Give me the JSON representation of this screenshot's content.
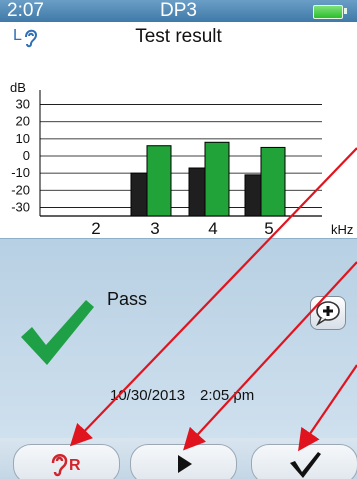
{
  "status_bar": {
    "time": "2:07",
    "title": "DP3",
    "battery_icon": "battery-full-icon"
  },
  "chart_panel": {
    "title": "Test result",
    "ear_icon": "left-ear-icon",
    "ear_label": "L"
  },
  "chart_data": {
    "type": "bar",
    "ylabel": "dB",
    "xlabel": "kHz",
    "ylim": [
      -35,
      35
    ],
    "yticks": [
      30,
      20,
      10,
      0,
      -10,
      -20,
      -30
    ],
    "categories": [
      "2",
      "3",
      "4",
      "5"
    ],
    "series": [
      {
        "color": "#1f1f1f",
        "values": [
          null,
          -10,
          -7,
          -11
        ]
      },
      {
        "color": "#22a33a",
        "values": [
          null,
          6,
          8,
          5
        ]
      }
    ]
  },
  "result": {
    "status": "Pass",
    "check_icon": "check-icon",
    "comment_icon": "comment-add-icon",
    "date": "10/30/2013",
    "time": "2:05 pm"
  },
  "softkeys": {
    "left_icon": "right-ear-icon",
    "left_label": "R",
    "middle_icon": "play-icon",
    "right_icon": "checkmark-icon"
  },
  "colors": {
    "accent_red": "#e0141e",
    "pass_green": "#1fa046",
    "statusbar_blue": "#4a84b1",
    "ear_blue": "#2e6fb7",
    "r_ear_red": "#d1242c"
  }
}
